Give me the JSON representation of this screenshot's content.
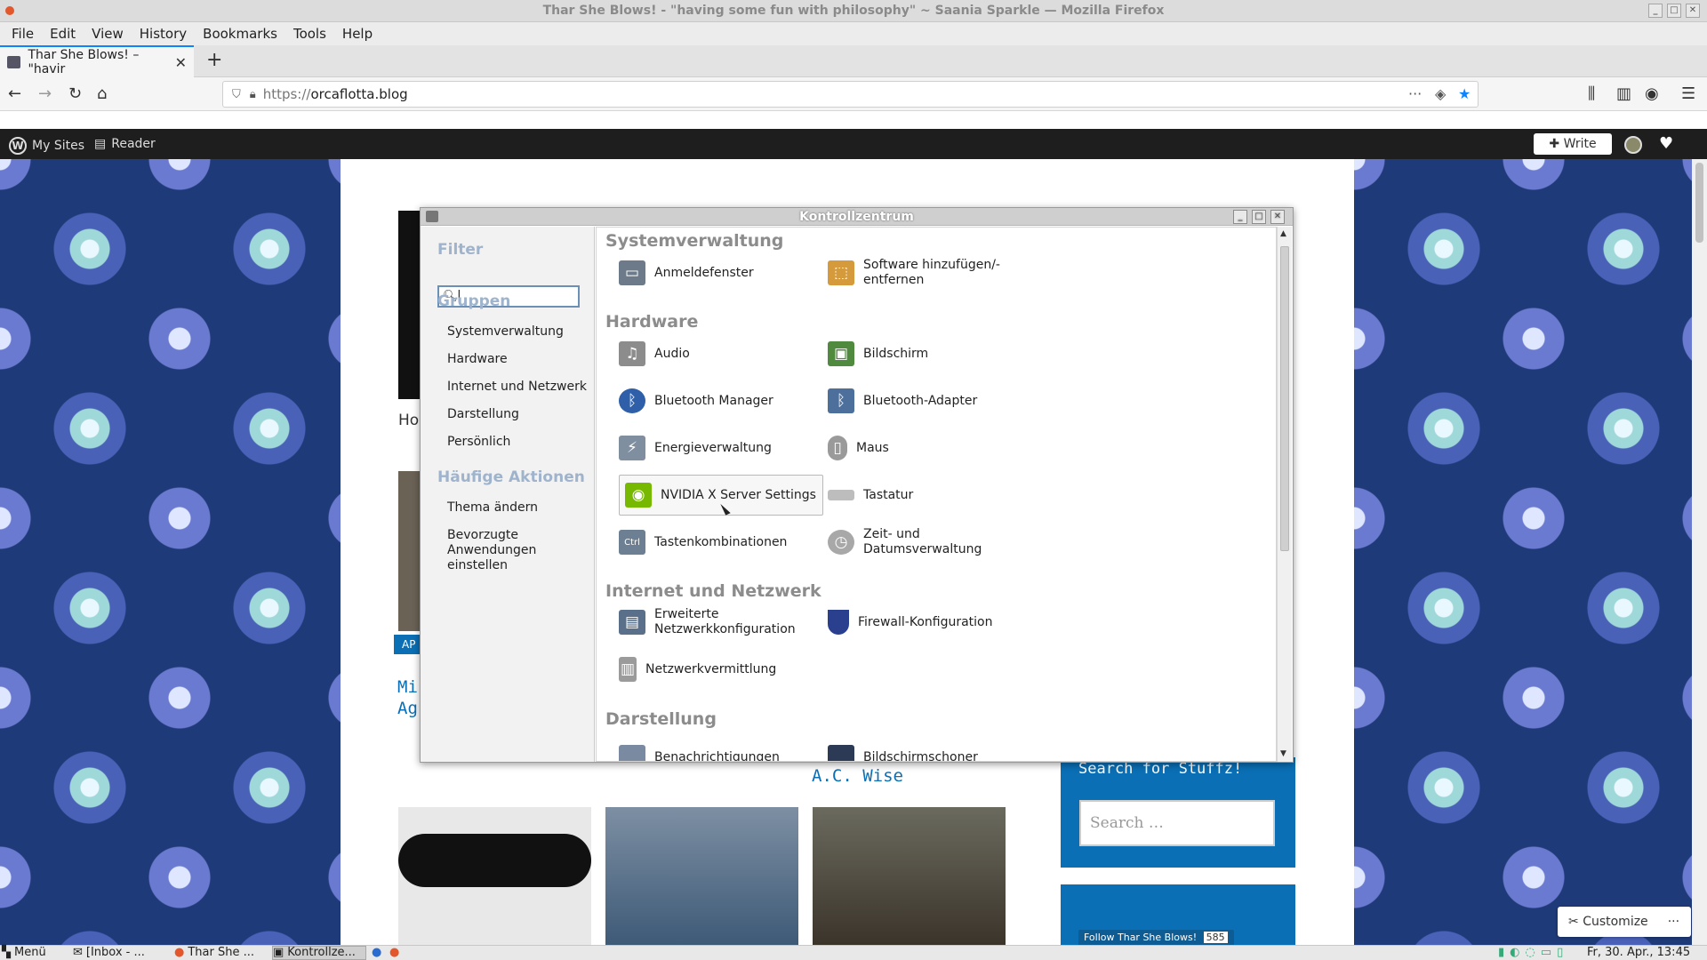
{
  "window": {
    "title": "Thar She Blows! - \"having some fun with philosophy\" ~ Saania Sparkle — Mozilla Firefox",
    "minimize": "_",
    "maximize": "□",
    "close": "✕"
  },
  "menubar": [
    "File",
    "Edit",
    "View",
    "History",
    "Bookmarks",
    "Tools",
    "Help"
  ],
  "tab": {
    "label": "Thar She Blows! – \"havir",
    "close": "✕",
    "new": "+"
  },
  "nav": {
    "back": "←",
    "forward": "→",
    "reload": "↻",
    "home": "⌂",
    "url_prefix": "https://",
    "url_host": "orcaflotta.blog",
    "more": "···",
    "pocket": "◈",
    "star": "★",
    "library": "⫼",
    "sidebar": "▥",
    "account": "◉",
    "menu": "☰"
  },
  "wpbar": {
    "my_sites": "My Sites",
    "reader": "Reader",
    "write": "Write"
  },
  "page": {
    "ho": "Ho",
    "badge": "AP",
    "left_link_1": "Mi",
    "left_link_2": "Ag",
    "ac_wise": "A.C. Wise",
    "search_label": "Search for Stuffz!",
    "search_placeholder": "Search …",
    "follow": "Follow Thar She Blows!",
    "follow_count": "585",
    "customize": "Customize",
    "customize_more": "···"
  },
  "dialog": {
    "title": "Kontrollzentrum",
    "filter_heading": "Filter",
    "groups_heading": "Gruppen",
    "groups": [
      "Systemverwaltung",
      "Hardware",
      "Internet und Netzwerk",
      "Darstellung",
      "Persönlich"
    ],
    "actions_heading": "Häufige Aktionen",
    "actions": [
      "Thema ändern",
      "Bevorzugte",
      "Anwendungen",
      "einstellen"
    ],
    "categories": {
      "system": "Systemverwaltung",
      "hardware": "Hardware",
      "internet": "Internet und Netzwerk",
      "display": "Darstellung"
    },
    "entries": {
      "anmeldefenster": "Anmeldefenster",
      "software_1": "Software hinzufügen/-",
      "software_2": "entfernen",
      "audio": "Audio",
      "bildschirm": "Bildschirm",
      "bt_manager": "Bluetooth Manager",
      "bt_adapter": "Bluetooth-Adapter",
      "energie": "Energieverwaltung",
      "maus": "Maus",
      "nvidia": "NVIDIA X Server Settings",
      "tastatur": "Tastatur",
      "tastenkomb": "Tastenkombinationen",
      "zeit_1": "Zeit- und",
      "zeit_2": "Datumsverwaltung",
      "netz_1": "Erweiterte",
      "netz_2": "Netzwerkkonfiguration",
      "firewall": "Firewall-Konfiguration",
      "netzvermittlung": "Netzwerkvermittlung",
      "benachrichtigungen": "Benachrichtigungen",
      "bildschirmschoner": "Bildschirmschoner"
    }
  },
  "taskbar": {
    "menu": "Menü",
    "inbox": "[Inbox - ...",
    "thar": "Thar She ...",
    "kontroll": "Kontrollze...",
    "clock": "Fr, 30. Apr., 13:45"
  },
  "colors": {
    "accent": "#0a84ff",
    "wp_blue": "#0a6fb5",
    "pattern_dark": "#1f3a78",
    "dialog_heading": "#9fb4cc"
  }
}
